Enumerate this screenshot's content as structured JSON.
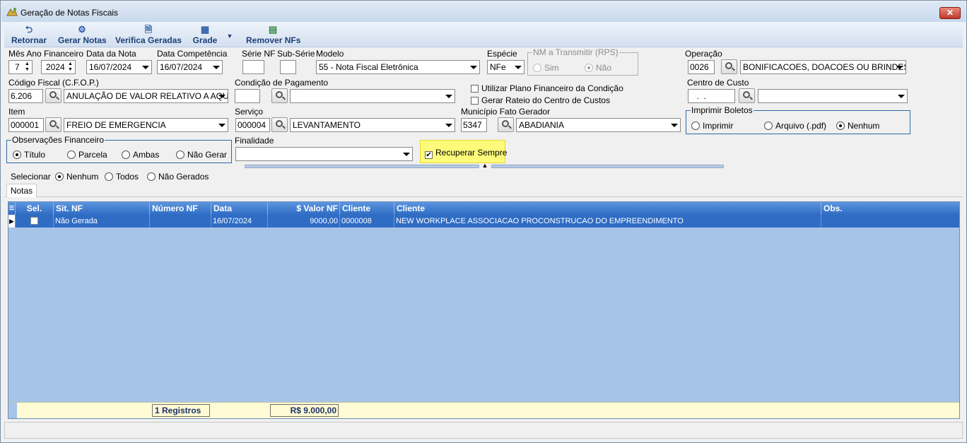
{
  "window": {
    "title": "Geração de Notas Fiscais",
    "close_label": "✕"
  },
  "toolbar": {
    "retornar": "Retornar",
    "gerar_notas": "Gerar Notas",
    "verifica_geradas": "Verifica Geradas",
    "grade": "Grade",
    "remover_nfs": "Remover NFs"
  },
  "form": {
    "mes_ano_label": "Mês Ano Financeiro",
    "mes_value": "7",
    "ano_value": "2024",
    "data_nota_label": "Data da Nota",
    "data_nota_value": "16/07/2024",
    "data_competencia_label": "Data Competência",
    "data_competencia_value": "16/07/2024",
    "serie_nf_label": "Série NF",
    "serie_nf_value": "",
    "sub_serie_label": "Sub-Série",
    "sub_serie_value": "",
    "modelo_label": "Modelo",
    "modelo_value": "55 - Nota Fiscal Eletrônica",
    "especie_label": "Espécie",
    "especie_value": "NFe",
    "nm_transmitir_label": "NM a Transmitir (RPS)",
    "nm_sim": "Sim",
    "nm_nao": "Não",
    "operacao_label": "Operação",
    "operacao_code": "0026",
    "operacao_value": "BONIFICACOES, DOACOES OU BRINDES",
    "cfop_label": "Código Fiscal (C.F.O.P.)",
    "cfop_code": "6.206",
    "cfop_value": "ANULAÇÃO DE VALOR RELATIVO A AQU",
    "condicao_label": "Condição de Pagamento",
    "condicao_code": "",
    "condicao_value": "",
    "utilizar_plano": "Utilizar Plano Financeiro da Condição",
    "gerar_rateio": "Gerar Rateio do Centro de Custos",
    "centro_custo_label": "Centro de Custo",
    "centro_custo_code": " .  .",
    "centro_custo_value": "",
    "item_label": "Item",
    "item_code": "000001",
    "item_value": "FREIO DE EMERGENCIA",
    "servico_label": "Serviço",
    "servico_code": "000004",
    "servico_value": "LEVANTAMENTO",
    "municipio_label": "Município Fato Gerador",
    "municipio_code": "5347",
    "municipio_value": "ABADIANIA",
    "imprimir_boletos_label": "Imprimir Boletos",
    "imprimir": "Imprimir",
    "arquivo_pdf": "Arquivo (.pdf)",
    "nenhum_boleto": "Nenhum",
    "obs_fin_label": "Observações Financeiro",
    "titulo": "Título",
    "parcela": "Parcela",
    "ambas": "Ambas",
    "nao_gerar": "Não Gerar",
    "finalidade_label": "Finalidade",
    "finalidade_value": "",
    "recuperar_sempre": "Recuperar Sempre"
  },
  "selection": {
    "label": "Selecionar",
    "nenhum": "Nenhum",
    "todos": "Todos",
    "nao_gerados": "Não Gerados"
  },
  "tabs": {
    "notas": "Notas"
  },
  "grid": {
    "columns": [
      "Sel.",
      "Sit. NF",
      "Número NF",
      "Data",
      "$ Valor NF",
      "Cliente",
      "Cliente",
      "Obs."
    ],
    "rows": [
      {
        "sit_nf": "Não Gerada",
        "numero_nf": "",
        "data": "16/07/2024",
        "valor": "9000,00",
        "cliente_code": "0000008",
        "cliente_nome": "NEW WORKPLACE ASSOCIACAO PROCONSTRUCAO DO EMPREENDIMENTO",
        "obs": ""
      }
    ],
    "footer_registros": "1 Registros",
    "footer_total": "R$ 9.000,00"
  },
  "colors": {
    "accent": "#2f6cc4",
    "grid_bg": "#a6c4e8",
    "highlight": "#fffb7a"
  }
}
